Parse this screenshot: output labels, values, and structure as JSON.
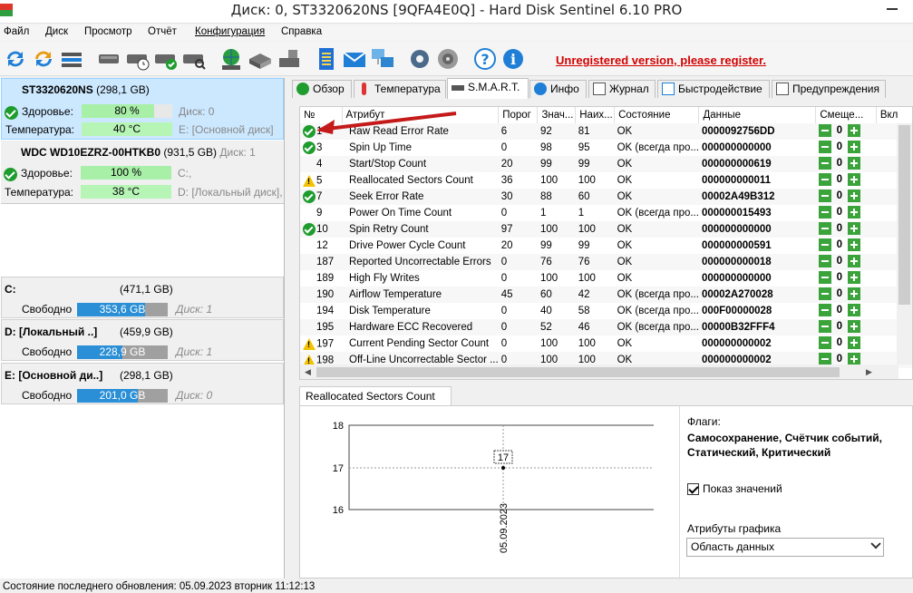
{
  "window": {
    "title": "Диск: 0, ST3320620NS [9QFA4E0Q]  -  Hard Disk Sentinel 6.10 PRO"
  },
  "menu": [
    "Файл",
    "Диск",
    "Просмотр",
    "Отчёт",
    "Конфигурация",
    "Справка"
  ],
  "toolbar": {
    "icons": [
      "refresh-icon",
      "refresh-all-icon",
      "drive-list-icon",
      "drive-check-icon",
      "drive-schedule-icon",
      "drive-ok-icon",
      "drive-search-icon",
      "network-icon",
      "scanner-icon",
      "drive-tools-icon",
      "notes-icon",
      "mail-icon",
      "computer-network-icon",
      "settings-gear-icon",
      "sound-icon",
      "help-icon",
      "info-icon"
    ],
    "unregistered": "Unregistered version, please register."
  },
  "disks": [
    {
      "name": "ST3320620NS",
      "size": "(298,1 GB)",
      "disk_no": "",
      "health_label": "Здоровье:",
      "health": "80 %",
      "health_level": 80,
      "temp_label": "Температура:",
      "temp": "40 °C",
      "drive_info": "E: [Основной диск]",
      "disk_tag": "Диск: 0"
    },
    {
      "name": "WDC WD10EZRZ-00HTKB0",
      "size": "(931,5 GB)",
      "disk_no": "Диск: 1",
      "health_label": "Здоровье:",
      "health": "100 %",
      "health_level": 100,
      "temp_label": "Температура:",
      "temp": "38 °C",
      "drive_info": "D: [Локальный диск],",
      "disk_tag": "C:,"
    }
  ],
  "partitions": [
    {
      "name": "C:",
      "size": "(471,1 GB)",
      "free_label": "Свободно",
      "free": "353,6 GB",
      "free_ratio": 0.75,
      "disk": "Диск: 1"
    },
    {
      "name": "D: [Локальный ..]",
      "size": "(459,9 GB)",
      "free_label": "Свободно",
      "free": "228,9 GB",
      "free_ratio": 0.5,
      "disk": "Диск: 1"
    },
    {
      "name": "E: [Основной ди..]",
      "size": "(298,1 GB)",
      "free_label": "Свободно",
      "free": "201,0 GB",
      "free_ratio": 0.67,
      "disk": "Диск: 0"
    }
  ],
  "tabs": [
    "Обзор",
    "Температура",
    "S.M.A.R.T.",
    "Инфо",
    "Журнал",
    "Быстродействие",
    "Предупреждения"
  ],
  "smart": {
    "headers": [
      "№",
      "Атрибут",
      "Порог",
      "Знач...",
      "Наих...",
      "Состояние",
      "Данные",
      "Смеще...",
      "Вкл"
    ],
    "rows": [
      {
        "status": "ok",
        "id": "1",
        "attr": "Raw Read Error Rate",
        "thr": "6",
        "val": "92",
        "worst": "81",
        "state": "OK",
        "data": "0000092756DD",
        "offset": "0"
      },
      {
        "status": "ok",
        "id": "3",
        "attr": "Spin Up Time",
        "thr": "0",
        "val": "98",
        "worst": "95",
        "state": "OK (всегда про...",
        "data": "000000000000",
        "offset": "0"
      },
      {
        "status": "none",
        "id": "4",
        "attr": "Start/Stop Count",
        "thr": "20",
        "val": "99",
        "worst": "99",
        "state": "OK",
        "data": "000000000619",
        "offset": "0"
      },
      {
        "status": "warn",
        "id": "5",
        "attr": "Reallocated Sectors Count",
        "thr": "36",
        "val": "100",
        "worst": "100",
        "state": "OK",
        "data": "000000000011",
        "offset": "0"
      },
      {
        "status": "ok",
        "id": "7",
        "attr": "Seek Error Rate",
        "thr": "30",
        "val": "88",
        "worst": "60",
        "state": "OK",
        "data": "00002A49B312",
        "offset": "0"
      },
      {
        "status": "none",
        "id": "9",
        "attr": "Power On Time Count",
        "thr": "0",
        "val": "1",
        "worst": "1",
        "state": "OK (всегда про...",
        "data": "000000015493",
        "offset": "0"
      },
      {
        "status": "ok",
        "id": "10",
        "attr": "Spin Retry Count",
        "thr": "97",
        "val": "100",
        "worst": "100",
        "state": "OK",
        "data": "000000000000",
        "offset": "0"
      },
      {
        "status": "none",
        "id": "12",
        "attr": "Drive Power Cycle Count",
        "thr": "20",
        "val": "99",
        "worst": "99",
        "state": "OK",
        "data": "000000000591",
        "offset": "0"
      },
      {
        "status": "none",
        "id": "187",
        "attr": "Reported Uncorrectable Errors",
        "thr": "0",
        "val": "76",
        "worst": "76",
        "state": "OK",
        "data": "000000000018",
        "offset": "0"
      },
      {
        "status": "none",
        "id": "189",
        "attr": "High Fly Writes",
        "thr": "0",
        "val": "100",
        "worst": "100",
        "state": "OK",
        "data": "000000000000",
        "offset": "0"
      },
      {
        "status": "none",
        "id": "190",
        "attr": "Airflow Temperature",
        "thr": "45",
        "val": "60",
        "worst": "42",
        "state": "OK (всегда про...",
        "data": "00002A270028",
        "offset": "0"
      },
      {
        "status": "none",
        "id": "194",
        "attr": "Disk Temperature",
        "thr": "0",
        "val": "40",
        "worst": "58",
        "state": "OK (всегда про...",
        "data": "000F00000028",
        "offset": "0"
      },
      {
        "status": "none",
        "id": "195",
        "attr": "Hardware ECC Recovered",
        "thr": "0",
        "val": "52",
        "worst": "46",
        "state": "OK (всегда про...",
        "data": "00000B32FFF4",
        "offset": "0"
      },
      {
        "status": "warn",
        "id": "197",
        "attr": "Current Pending Sector Count",
        "thr": "0",
        "val": "100",
        "worst": "100",
        "state": "OK",
        "data": "000000000002",
        "offset": "0"
      },
      {
        "status": "warn",
        "id": "198",
        "attr": "Off-Line Uncorrectable Sector ...",
        "thr": "0",
        "val": "100",
        "worst": "100",
        "state": "OK",
        "data": "000000000002",
        "offset": "0"
      }
    ]
  },
  "graph": {
    "tab": "Reallocated Sectors Count",
    "y_ticks": [
      "18",
      "17",
      "16"
    ],
    "point_label": "17",
    "x_label": "05.09.2023",
    "flags_title": "Флаги:",
    "flags_value": "Самосохранение, Счётчик событий, Статический, Критический",
    "show_values": "Показ значений",
    "attrs_title": "Атрибуты графика",
    "attrs_value": "Область данных"
  },
  "status_bar": "Состояние последнего обновления: 05.09.2023 вторник 11:12:13",
  "colors": {
    "accent_red": "#d40000",
    "ok_green": "#1e9c2e",
    "warn_yellow": "#f2c200",
    "selection": "#cce8ff"
  }
}
